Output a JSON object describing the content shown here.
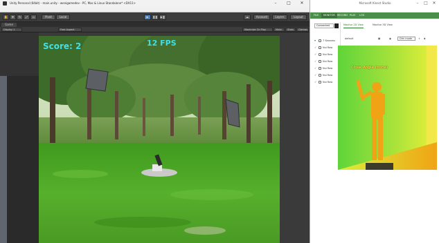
{
  "unity": {
    "window_title": "Unity Personal (64bit) - main.unity - wenigamedev - PC, Mac & Linux Standalone* <DX11>",
    "menu": [
      "File",
      "Edit",
      "Assets",
      "GameObject",
      "Component",
      "Mobile Input",
      "Window",
      "Help"
    ],
    "toolbar": {
      "layers_label": "Layers",
      "layout_label": "Layout",
      "account_label": "Account",
      "pivot_label": "Pivot",
      "local_label": "Local"
    },
    "tab_label": "Game",
    "gamebar": {
      "display_label": "Display 1",
      "aspect_label": "Free Aspect",
      "maximize_label": "Maximize On Play",
      "mute_label": "Mute",
      "stats_label": "Stats",
      "gizmos_label": "Gizmos"
    },
    "hud": {
      "score": "Score: 2",
      "fps": "12 FPS"
    }
  },
  "kinect": {
    "window_title": "Microsoft Kinect Studio",
    "tabs": [
      "FILE",
      "MONITOR",
      "RECORD",
      "PLAY",
      "LOG"
    ],
    "active_tab": "MONITOR",
    "connect_label": "Connected",
    "streams_header": "7 Streams",
    "streams": [
      "Nui Raw",
      "Nui Raw",
      "Nui Raw",
      "Nui Raw",
      "Nui Raw",
      "Nui Raw"
    ],
    "views": [
      "Monitor 2D View",
      "Monitor 3D View"
    ],
    "active_view": "Monitor 2D View",
    "view_tool_label": "default",
    "view_dropdown": "Dim mode",
    "depth_overlay_label": "Close Angle (none)"
  },
  "colors": {
    "hud_text": "#40e0e8",
    "kinect_tab_bar": "#4a8f4a",
    "depth_bg_green": "#5fd43a",
    "depth_bg_yellow": "#e9f03a",
    "depth_person": "#f0a415"
  }
}
